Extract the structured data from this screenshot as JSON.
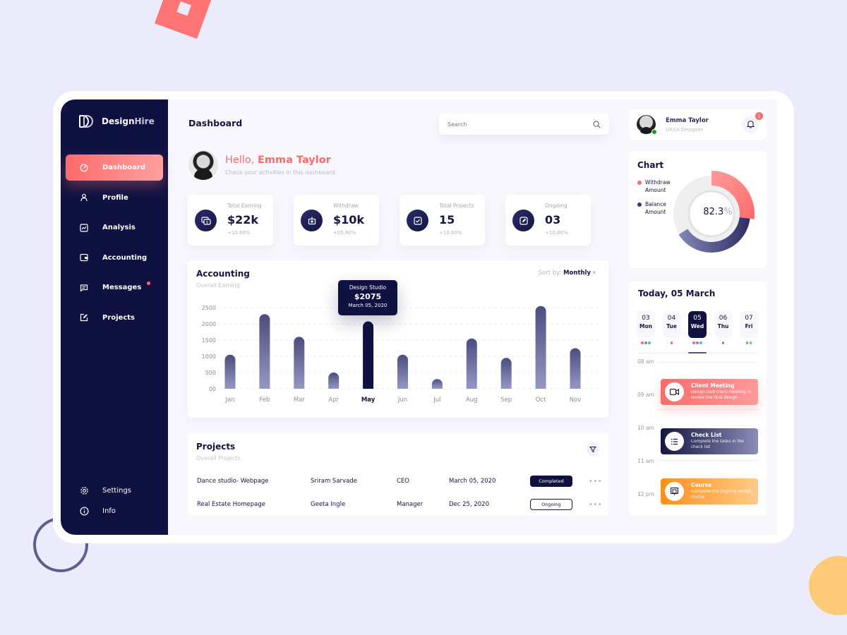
{
  "brand": {
    "name_part1": "Design",
    "name_part2": "Hire"
  },
  "sidebar": {
    "items": [
      {
        "label": "Dashboard",
        "icon": "dashboard-gauge-icon",
        "active": true
      },
      {
        "label": "Profile",
        "icon": "user-icon"
      },
      {
        "label": "Analysis",
        "icon": "analysis-chart-icon"
      },
      {
        "label": "Accounting",
        "icon": "wallet-icon"
      },
      {
        "label": "Messages",
        "icon": "message-icon",
        "badge_dot": true
      },
      {
        "label": "Projects",
        "icon": "edit-square-icon"
      }
    ],
    "bottom_items": [
      {
        "label": "Settings",
        "icon": "gear-icon"
      },
      {
        "label": "Info",
        "icon": "info-icon"
      }
    ]
  },
  "header": {
    "title": "Dashboard",
    "search_placeholder": "Search"
  },
  "greeting": {
    "hello": "Hello, ",
    "name": "Emma Taylor",
    "subtitle": "Check your activities in this dashboard."
  },
  "stats": [
    {
      "label": "Total Earning",
      "value": "$22k",
      "delta": "+10.80%",
      "icon": "money-icon"
    },
    {
      "label": "Withdraw",
      "value": "$10k",
      "delta": "+05.80%",
      "icon": "atm-withdraw-icon"
    },
    {
      "label": "Total Projects",
      "value": "15",
      "delta": "+10.80%",
      "icon": "checkbox-icon"
    },
    {
      "label": "Ongoing",
      "value": "03",
      "delta": "+10.80%",
      "icon": "edit-icon"
    }
  ],
  "accounting": {
    "title": "Accounting",
    "subtitle": "Overall Earning",
    "sort_label": "Sort by: ",
    "sort_value": "Monthly",
    "tooltip": {
      "title": "Design Studio",
      "value": "$2075",
      "date": "March 05, 2020"
    }
  },
  "chart_data": [
    {
      "type": "bar",
      "title": "Accounting",
      "subtitle": "Overall Earning",
      "categories": [
        "Jan",
        "Feb",
        "Mar",
        "Apr",
        "May",
        "Jun",
        "Jul",
        "Aug",
        "Sep",
        "Oct",
        "Nov"
      ],
      "values": [
        1050,
        2300,
        1600,
        500,
        2075,
        1050,
        300,
        1550,
        950,
        2550,
        1250
      ],
      "highlight_index": 4,
      "y_ticks": [
        "00",
        "500",
        "1000",
        "1500",
        "2000",
        "2500"
      ],
      "ylim": [
        0,
        2500
      ],
      "grid": true,
      "colors": {
        "bar_top": "#4b4d7e",
        "bar_bottom": "#9597c3",
        "highlight": "#0f1241"
      }
    },
    {
      "type": "pie",
      "title": "Chart",
      "center_label": "82.3",
      "center_unit": "%",
      "legend": [
        "Withdraw Amount",
        "Balance Amount"
      ],
      "slices": [
        {
          "name": "Withdraw Amount",
          "fraction": 0.27,
          "color": "#ff6b6b"
        },
        {
          "name": "Balance Amount",
          "fraction": 0.39,
          "color": "#3b3d6e"
        },
        {
          "name": "Remaining",
          "fraction": 0.34,
          "color": "#ececec"
        }
      ],
      "legend_placement": "left"
    }
  ],
  "projects": {
    "title": "Projects",
    "subtitle": "Overall Projects",
    "rows": [
      {
        "name": "Dance studio- Webpage",
        "person": "Sriram Sarvade",
        "role": "CEO",
        "date": "March 05, 2020",
        "status": "Completed"
      },
      {
        "name": "Real Estate Homepage",
        "person": "Geeta Ingle",
        "role": "Manager",
        "date": "Dec 25, 2020",
        "status": "Ongoing"
      }
    ]
  },
  "profile": {
    "name": "Emma Taylor",
    "role": "UX/UI Designer",
    "notifications": "2"
  },
  "donut": {
    "title": "Chart",
    "legend": [
      {
        "line1": "Withdraw",
        "line2": "Amount",
        "color": "#ff6b6b"
      },
      {
        "line1": "Balance",
        "line2": "Amount",
        "color": "#3b3d6e"
      }
    ],
    "value": "82.3",
    "unit": "%"
  },
  "calendar": {
    "title": "Today, 05 March",
    "days": [
      {
        "num": "03",
        "name": "Mon",
        "dots": [
          "#ff6b6b",
          "#8b7cf6",
          "#4cd18a"
        ]
      },
      {
        "num": "04",
        "name": "Tue",
        "dots": [
          "#ff6b6b"
        ]
      },
      {
        "num": "05",
        "name": "Wed",
        "dots": [
          "#ff6b6b",
          "#8b7cf6",
          "#4cd18a"
        ],
        "active": true
      },
      {
        "num": "06",
        "name": "Thu",
        "dots": [
          "#8b7cf6"
        ]
      },
      {
        "num": "07",
        "name": "Fri",
        "dots": [
          "#ff6b6b",
          "#4cd18a"
        ]
      }
    ],
    "times": [
      "08 am",
      "09 am",
      "10 am",
      "11 am",
      "12 pm"
    ],
    "events": [
      {
        "title": "Client Meeting",
        "desc": "Design club client meeting to review the final deisgn",
        "icon": "video-camera-icon"
      },
      {
        "title": "Check List",
        "desc": "Complete the tasks in the check list",
        "icon": "checklist-icon"
      },
      {
        "title": "Course",
        "desc": "Complete the ongoing design course",
        "icon": "course-icon"
      }
    ]
  }
}
